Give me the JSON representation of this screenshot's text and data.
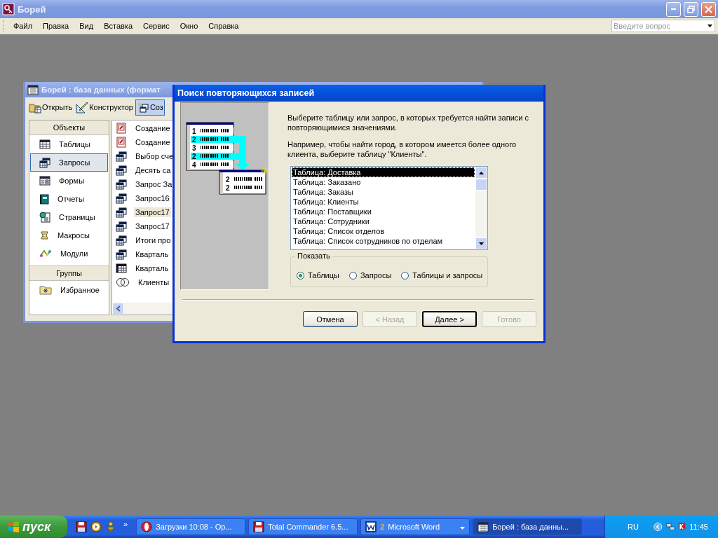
{
  "app": {
    "title": "Борей",
    "help_field": {
      "placeholder": "Введите вопрос"
    }
  },
  "menu": [
    "Файл",
    "Правка",
    "Вид",
    "Вставка",
    "Сервис",
    "Окно",
    "Справка"
  ],
  "db_window": {
    "title": "Борей : база данных (формат",
    "toolbar": [
      {
        "label": "Открыть",
        "kind": "open",
        "selected": false
      },
      {
        "label": "Конструктор",
        "kind": "design",
        "selected": false
      },
      {
        "label": "Соз",
        "kind": "new",
        "selected": true
      }
    ],
    "objects_header": "Объекты",
    "objects": [
      {
        "label": "Таблицы",
        "kind": "table",
        "selected": false
      },
      {
        "label": "Запросы",
        "kind": "query",
        "selected": true
      },
      {
        "label": "Формы",
        "kind": "form",
        "selected": false
      },
      {
        "label": "Отчеты",
        "kind": "report",
        "selected": false
      },
      {
        "label": "Страницы",
        "kind": "page",
        "selected": false
      },
      {
        "label": "Макросы",
        "kind": "macro",
        "selected": false
      },
      {
        "label": "Модули",
        "kind": "module",
        "selected": false
      }
    ],
    "groups_header": "Группы",
    "groups": [
      {
        "label": "Избранное",
        "kind": "favorites",
        "selected": false
      }
    ],
    "items": [
      {
        "label": "Создание",
        "kind": "wizard",
        "selected": false
      },
      {
        "label": "Создание",
        "kind": "wizard",
        "selected": false
      },
      {
        "label": "Выбор сче",
        "kind": "query",
        "selected": false
      },
      {
        "label": "Десять са",
        "kind": "query",
        "selected": false
      },
      {
        "label": "Запрос За",
        "kind": "query",
        "selected": false
      },
      {
        "label": "Запрос16",
        "kind": "query",
        "selected": false
      },
      {
        "label": "Запрос17",
        "kind": "query",
        "selected": true
      },
      {
        "label": "Запрос17",
        "kind": "query",
        "selected": false
      },
      {
        "label": "Итоги про",
        "kind": "query",
        "selected": false
      },
      {
        "label": "Кварталь",
        "kind": "query",
        "selected": false
      },
      {
        "label": "Кварталь",
        "kind": "crosstab",
        "selected": false
      },
      {
        "label": "Клиенты",
        "kind": "union",
        "selected": false
      }
    ]
  },
  "dialog": {
    "title": "Поиск повторяющихся записей",
    "illustration": {
      "source_rows": [
        {
          "number": "1",
          "selected": false
        },
        {
          "number": "2",
          "selected": true
        },
        {
          "number": "3",
          "selected": false
        },
        {
          "number": "2",
          "selected": true
        },
        {
          "number": "4",
          "selected": false
        }
      ],
      "result_rows": [
        {
          "number": "2"
        },
        {
          "number": "2"
        }
      ]
    },
    "paragraphs": [
      "Выберите таблицу или запрос, в которых требуется найти записи с повторяющимися значениями.",
      "Например, чтобы найти город, в котором имеется более одного клиента, выберите таблицу \"Клиенты\"."
    ],
    "list": [
      {
        "label": "Таблица: Доставка",
        "selected": true
      },
      {
        "label": "Таблица: Заказано",
        "selected": false
      },
      {
        "label": "Таблица: Заказы",
        "selected": false
      },
      {
        "label": "Таблица: Клиенты",
        "selected": false
      },
      {
        "label": "Таблица: Поставщики",
        "selected": false
      },
      {
        "label": "Таблица: Сотрудники",
        "selected": false
      },
      {
        "label": "Таблица: Список отделов",
        "selected": false
      },
      {
        "label": "Таблица: Список сотрудников по отделам",
        "selected": false
      }
    ],
    "show_group": {
      "title": "Показать",
      "options": [
        {
          "label": "Таблицы",
          "selected": true
        },
        {
          "label": "Запросы",
          "selected": false
        },
        {
          "label": "Таблицы и запросы",
          "selected": false
        }
      ]
    },
    "buttons": [
      {
        "label": "Отмена",
        "disabled": false,
        "default": false
      },
      {
        "label": "< Назад",
        "disabled": true,
        "default": false
      },
      {
        "label": "Далее >",
        "disabled": false,
        "default": true
      },
      {
        "label": "Готово",
        "disabled": true,
        "default": false
      }
    ]
  },
  "taskbar": {
    "start": "пуск",
    "quick_launch": [
      {
        "kind": "floppy"
      },
      {
        "kind": "media"
      },
      {
        "kind": "game"
      }
    ],
    "more": "»",
    "tasks": [
      {
        "label": "Загрузки 10:08 - Ор...",
        "kind": "browser",
        "has_menu": false,
        "selected": false
      },
      {
        "label": "Total Commander 6.5...",
        "kind": "floppy",
        "has_menu": false,
        "selected": false
      },
      {
        "label": "Microsoft Word",
        "kind": "word",
        "count": "2",
        "has_menu": true,
        "selected": false
      },
      {
        "label": "Борей : база данны...",
        "kind": "database",
        "has_menu": false,
        "selected": true
      }
    ],
    "language": "RU",
    "clock": "11:45"
  }
}
